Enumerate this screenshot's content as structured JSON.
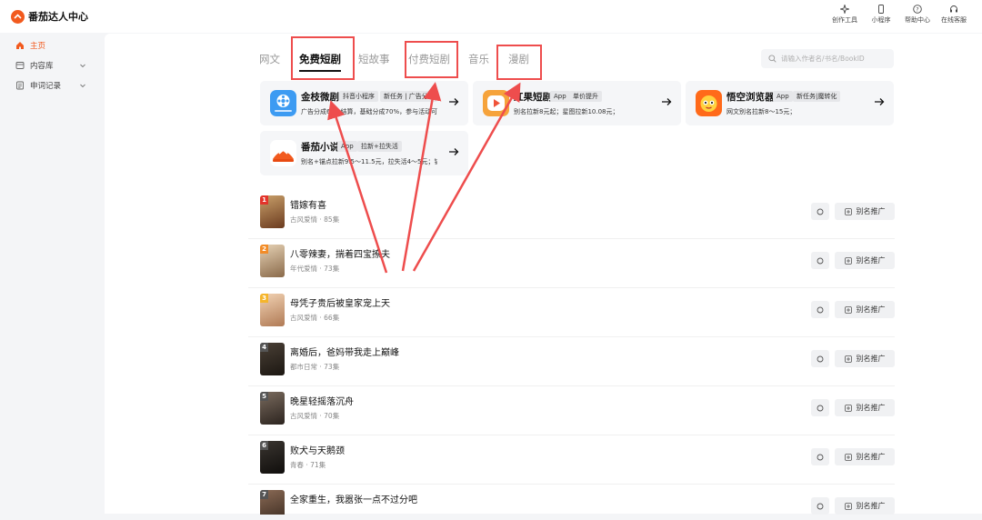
{
  "header": {
    "brand": "番茄达人中心",
    "tools": [
      {
        "label": "创作工具",
        "icon": "sparkle-icon"
      },
      {
        "label": "小程序",
        "icon": "phone-icon"
      },
      {
        "label": "帮助中心",
        "icon": "help-icon"
      },
      {
        "label": "在线客服",
        "icon": "headset-icon"
      }
    ]
  },
  "sidebar": {
    "items": [
      {
        "label": "主页",
        "icon": "home-icon",
        "active": true
      },
      {
        "label": "内容库",
        "icon": "library-icon"
      },
      {
        "label": "申词记录",
        "icon": "record-icon"
      }
    ]
  },
  "tabs": [
    {
      "label": "网文"
    },
    {
      "label": "免费短剧",
      "active": true
    },
    {
      "label": "短故事"
    },
    {
      "label": "付费短剧"
    },
    {
      "label": "音乐"
    },
    {
      "label": "漫剧"
    }
  ],
  "search": {
    "placeholder": "请输入作者名/书名/BookID"
  },
  "apps": [
    {
      "name": "金枝微剧",
      "tags": [
        "抖音小程序",
        "新任务 | 广告分..."
      ],
      "desc": "广告分成60%结算，基础分成70%，参与活动可..."
    },
    {
      "name": "红果短剧",
      "tags": [
        "App",
        "单价提升"
      ],
      "desc": "别名拉新8元起；星图拉新10.08元；"
    },
    {
      "name": "悟空浏览器",
      "tags": [
        "App",
        "新任务|魔转化"
      ],
      "desc": "网文别名拉新8～15元；"
    },
    {
      "name": "番茄小说",
      "tags": [
        "App",
        "拉新+拉失活"
      ],
      "desc": "别名+锚点拉新9.5～11.5元，拉失活4～5元；锚..."
    }
  ],
  "dramas": [
    {
      "rank": "1",
      "title": "错嫁有喜",
      "meta": "古风爱情 · 85集",
      "action": "别名推广"
    },
    {
      "rank": "2",
      "title": "八零辣妻，揣着四宝撩夫",
      "meta": "年代爱情 · 73集",
      "action": "别名推广"
    },
    {
      "rank": "3",
      "title": "母凭子贵后被皇家宠上天",
      "meta": "古风爱情 · 66集",
      "action": "别名推广"
    },
    {
      "rank": "4",
      "title": "离婚后，爸妈带我走上巅峰",
      "meta": "都市日常 · 73集",
      "action": "别名推广"
    },
    {
      "rank": "5",
      "title": "晚星轻摇落沉舟",
      "meta": "古风爱情 · 70集",
      "action": "别名推广"
    },
    {
      "rank": "6",
      "title": "败犬与天鹅颈",
      "meta": "青春 · 71集",
      "action": "别名推广"
    },
    {
      "rank": "7",
      "title": "全家重生，我嚣张一点不过分吧",
      "meta": "",
      "action": "别名推广"
    }
  ],
  "colors": {
    "accent": "#f25a1e",
    "annotation": "#ee4d4d"
  }
}
